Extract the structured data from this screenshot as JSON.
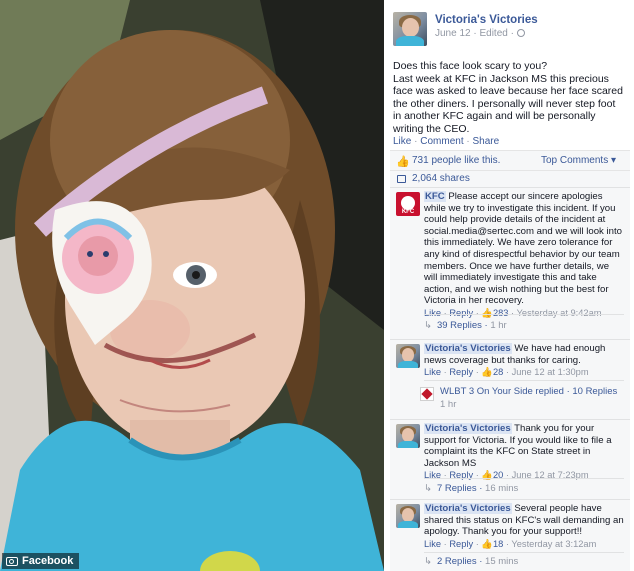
{
  "photo": {
    "watermark": "Facebook",
    "watermark_icon": "camera-icon"
  },
  "post": {
    "page_name": "Victoria's Victories",
    "meta": "June 12 · Edited ·",
    "text_lines": [
      "Does this face look scary to you?",
      "Last week at KFC in Jackson MS this precious face was asked to leave because her face scared the other diners. I personally will never step foot in another KFC again and will be personally writing the CEO."
    ],
    "actions": {
      "like": "Like",
      "comment": "Comment",
      "share": "Share",
      "sep": " · "
    },
    "likes_text": "731 people like this.",
    "top_comments": "Top Comments ▾",
    "shares_text": "2,064 shares"
  },
  "comments": [
    {
      "author": "KFC",
      "text": "Please accept our sincere apologies while we try to investigate this incident. If you could help provide details of the incident at social.media@sertec.com and we will look into this immediately. We have zero tolerance for any kind of disrespectful behavior by our team members. Once we have further details, we will immediately investigate this and take action, and we wish nothing but the best for Victoria in her recovery.",
      "like": "Like",
      "reply": "Reply",
      "likes": "283",
      "time": "Yesterday at 9:42am",
      "replies_label": "39 Replies",
      "replies_time": "1 hr"
    },
    {
      "author": "Victoria's Victories",
      "text": "We have had enough news coverage but thanks for caring.",
      "like": "Like",
      "reply": "Reply",
      "likes": "28",
      "time": "June 12 at 1:30pm",
      "replies_label": "WLBT 3 On Your Side replied · 10 Replies",
      "replies_time": "1 hr"
    },
    {
      "author": "Victoria's Victories",
      "text": "Thank you for your support for Victoria. If you would like to file a complaint its the KFC on State street in Jackson MS",
      "like": "Like",
      "reply": "Reply",
      "likes": "20",
      "time": "June 12 at 7:23pm",
      "replies_label": "7 Replies",
      "replies_time": "16 mins"
    },
    {
      "author": "Victoria's Victories",
      "text": "Several people have shared this status on KFC's wall demanding an apology. Thank you for your support!!",
      "like": "Like",
      "reply": "Reply",
      "likes": "18",
      "time": "Yesterday at 3:12am",
      "replies_label": "2 Replies",
      "replies_time": "15 mins"
    }
  ],
  "colors": {
    "link_blue": "#3b5998",
    "meta_gray": "#9197a3",
    "panel_bg": "#f6f7f8",
    "kfc_red": "#c8102e",
    "shirt_blue": "#3fb4d8"
  }
}
